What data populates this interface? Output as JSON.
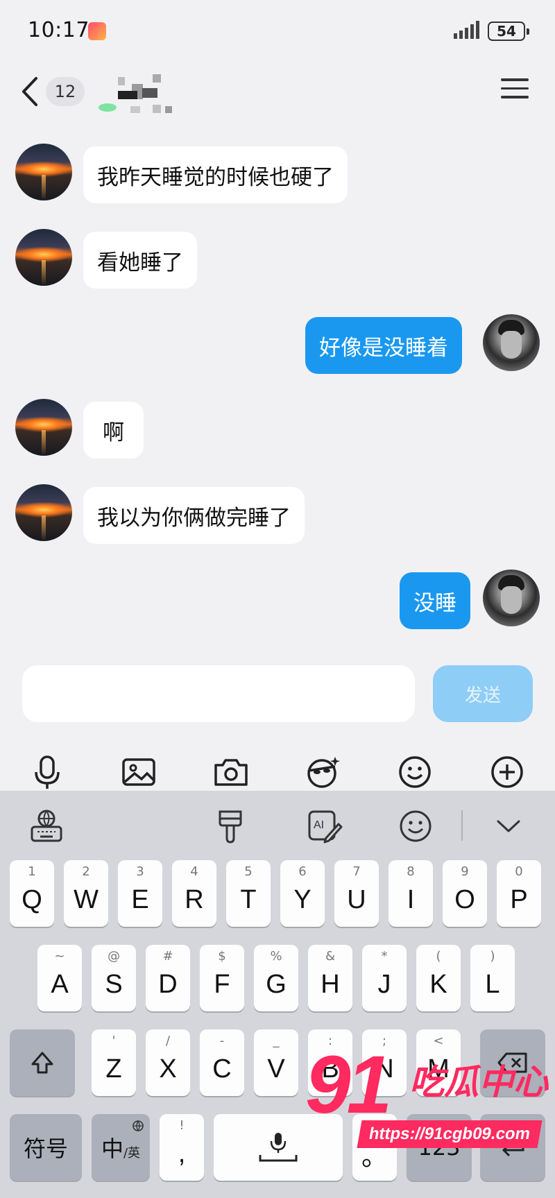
{
  "status_bar": {
    "time": "10:17",
    "battery": "54",
    "app_icon": "app-badge-icon",
    "signal_icon": "signal-icon"
  },
  "header": {
    "unread_count": "12",
    "back_icon": "chevron-left-icon",
    "menu_icon": "menu-icon"
  },
  "messages": [
    {
      "side": "left",
      "text": "我昨天睡觉的时候也硬了"
    },
    {
      "side": "left",
      "text": "看她睡了"
    },
    {
      "side": "right",
      "text": "好像是没睡着"
    },
    {
      "side": "left",
      "text": "啊"
    },
    {
      "side": "left",
      "text": "我以为你俩做完睡了"
    },
    {
      "side": "right",
      "text": "没睡"
    }
  ],
  "input": {
    "value": "",
    "send_label": "发送"
  },
  "tools": [
    "microphone-icon",
    "image-icon",
    "camera-icon",
    "ai-face-icon",
    "emoji-icon",
    "plus-icon"
  ],
  "keyboard": {
    "toolbar": [
      "keyboard-settings-icon",
      "brush-icon",
      "ai-write-icon",
      "emoji-icon",
      "collapse-icon"
    ],
    "row1": [
      {
        "hint": "1",
        "key": "Q"
      },
      {
        "hint": "2",
        "key": "W"
      },
      {
        "hint": "3",
        "key": "E"
      },
      {
        "hint": "4",
        "key": "R"
      },
      {
        "hint": "5",
        "key": "T"
      },
      {
        "hint": "6",
        "key": "Y"
      },
      {
        "hint": "7",
        "key": "U"
      },
      {
        "hint": "8",
        "key": "I"
      },
      {
        "hint": "9",
        "key": "O"
      },
      {
        "hint": "0",
        "key": "P"
      }
    ],
    "row2": [
      {
        "hint": "~",
        "key": "A"
      },
      {
        "hint": "@",
        "key": "S"
      },
      {
        "hint": "#",
        "key": "D"
      },
      {
        "hint": "$",
        "key": "F"
      },
      {
        "hint": "%",
        "key": "G"
      },
      {
        "hint": "&",
        "key": "H"
      },
      {
        "hint": "*",
        "key": "J"
      },
      {
        "hint": "(",
        "key": "K"
      },
      {
        "hint": ")",
        "key": "L"
      }
    ],
    "row3": [
      {
        "hint": "'",
        "key": "Z"
      },
      {
        "hint": "/",
        "key": "X"
      },
      {
        "hint": "-",
        "key": "C"
      },
      {
        "hint": "_",
        "key": "V"
      },
      {
        "hint": ":",
        "key": "B"
      },
      {
        "hint": ";",
        "key": "N"
      },
      {
        "hint": "<",
        "key": "M"
      }
    ],
    "symbols_label": "符号",
    "lang_label": "中",
    "lang_sub": "/英",
    "comma_hint": "!",
    "comma_key": ",",
    "period_key": "。",
    "numbers_label": "123"
  },
  "watermark": {
    "number": "91",
    "text": "吃瓜中心",
    "url": "https://91cgb09.com"
  }
}
